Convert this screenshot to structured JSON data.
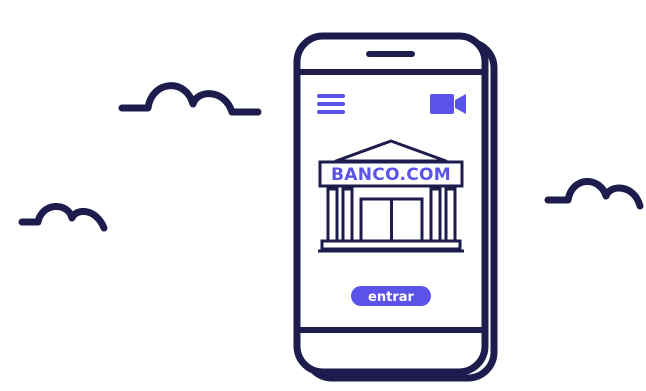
{
  "colors": {
    "navy": "#1e1b4d",
    "accent": "#5b53e8",
    "background": "#ffffff"
  },
  "bank": {
    "name": "BANCO.COM"
  },
  "actions": {
    "enter_label": "entrar"
  },
  "icons": {
    "menu": "hamburger-menu-icon",
    "video": "video-camera-icon",
    "bank": "bank-building-icon"
  }
}
